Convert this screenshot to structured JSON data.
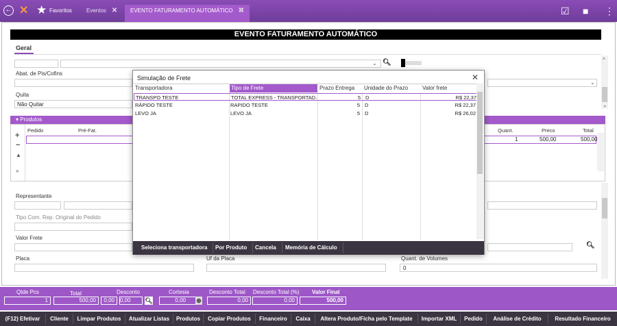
{
  "topbar": {
    "favorites": "Favoritos",
    "tabs": [
      {
        "label": "Eventos",
        "close": "✕"
      },
      {
        "label": "EVENTO FATURAMENTO AUTOMÁTICO",
        "close": "✕"
      }
    ]
  },
  "page": {
    "title": "EVENTO FATURAMENTO AUTOMÁTICO",
    "section_tab": "Geral",
    "abat_label": "Abat. de Pis/Cofins",
    "quita_label": "Quita",
    "quita_value": "Não Quitar"
  },
  "produtos": {
    "band_label": "Produtos",
    "col_pedido": "Pedido",
    "col_prefat": "Pré-Fat.",
    "col_quant": "Quant.",
    "col_preco": "Preco",
    "col_total": "Total",
    "row": {
      "quant": "1",
      "preco": "500,00",
      "total": "500,00"
    }
  },
  "lower": {
    "representante": "Representante",
    "tipo_com": "Tipo Com. Rep. Original do Pedido",
    "valor_frete": "Valor Frete",
    "placa": "Placa",
    "uf_placa": "Uf da Placa",
    "quant_volumes": "Quant. de Volumes",
    "quant_volumes_value": "0"
  },
  "modal": {
    "title": "Simulação de Frete",
    "close": "✕",
    "columns": [
      "Transportadora",
      "Tipo de Frete",
      "Prazo Entrega",
      "Unidade do Prazo",
      "Valor frete"
    ],
    "rows": [
      {
        "transportadora": "TRANSPO TESTE",
        "tipo": "TOTAL EXPRESS - TRANSPORTAD...",
        "prazo": "5",
        "unidade": "D",
        "valor": "R$ 22,37"
      },
      {
        "transportadora": "RÁPIDO TESTE",
        "tipo": "RAPIDO TESTE",
        "prazo": "5",
        "unidade": "D",
        "valor": "R$ 22,37"
      },
      {
        "transportadora": "LEVO JA",
        "tipo": "LEVO JA",
        "prazo": "5",
        "unidade": "D",
        "valor": "R$ 26,02"
      }
    ],
    "buttons": [
      "Seleciona transportadora",
      "Por Produto",
      "Cancela",
      "Memória de Cálculo"
    ]
  },
  "totals": {
    "qtde_pcs_label": "Qtde Pcs",
    "qtde_pcs": "1",
    "total_label": "Total",
    "total": "500,00",
    "desconto_label": "Desconto",
    "desconto_a": "0,00",
    "desconto_b": "0,00",
    "cortesia_label": "Cortesia",
    "cortesia": "0,00",
    "desc_total_label": "Desconto Total",
    "desc_total": "0,00",
    "desc_total_pct_label": "Desconto Total (%)",
    "desc_total_pct": "0,00",
    "valor_final_label": "Valor Final",
    "valor_final": "500,00"
  },
  "bottom_buttons": [
    "(F12) Efetivar",
    "Cliente",
    "Limpar Produtos",
    "Atualizar Listas",
    "Produtos",
    "Copiar Produtos",
    "Financeiro",
    "Caixa",
    "Altera Produto/Ficha pelo Template",
    "Importar XML",
    "Pedido",
    "Análise de Crédito",
    "Resultado Financeiro"
  ],
  "colors": {
    "accent": "#9e57c7",
    "dark": "#3b3542"
  }
}
